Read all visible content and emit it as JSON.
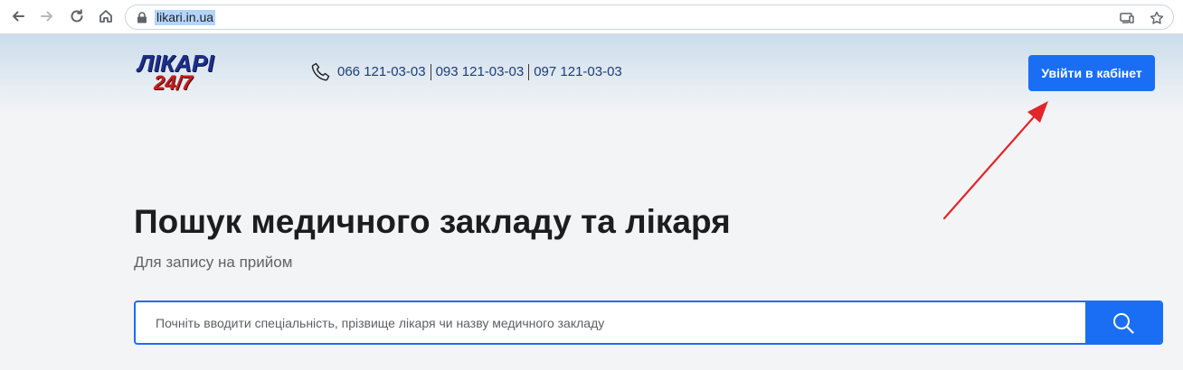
{
  "browser": {
    "url": "likari.in.ua",
    "icons": [
      "back-icon",
      "forward-icon",
      "reload-icon",
      "home-icon",
      "lock-icon",
      "cast-icon",
      "star-icon"
    ]
  },
  "header": {
    "logo_top": "ЛІКАРІ",
    "logo_bottom": "24/7",
    "phones": [
      "066 121-03-03",
      "093 121-03-03",
      "097 121-03-03"
    ],
    "login_label": "Увійти в кабінет"
  },
  "hero": {
    "title": "Пошук медичного закладу та лікаря",
    "subtitle": "Для запису на прийом"
  },
  "search": {
    "placeholder": "Почніть вводити спеціальність, прізвище лікаря чи назву медичного закладу",
    "value": ""
  },
  "colors": {
    "accent": "#1a6ef3",
    "phone_text": "#1d3c7a",
    "annotation_arrow": "#e0262b",
    "logo_blue": "#1d2f8c",
    "logo_red": "#c41f1f"
  }
}
